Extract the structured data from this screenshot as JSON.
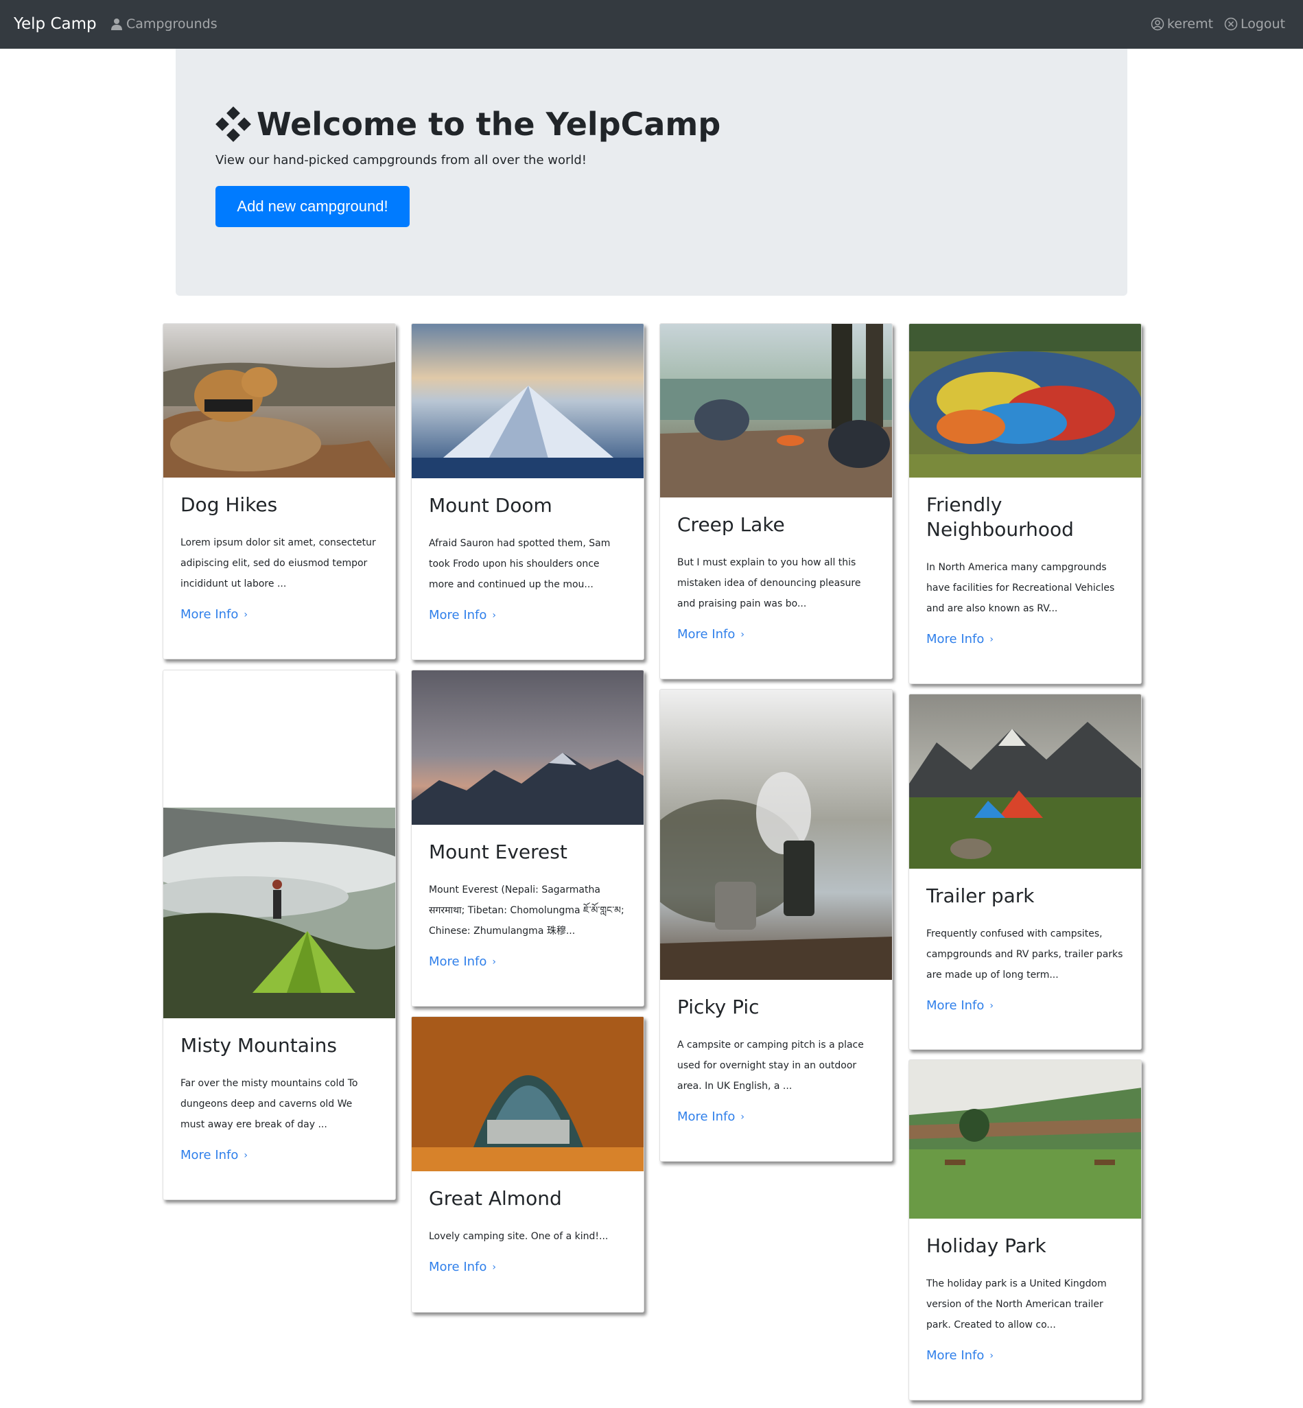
{
  "navbar": {
    "brand": "Yelp Camp",
    "campgrounds_label": "Campgrounds",
    "username": "keremt",
    "logout_label": "Logout"
  },
  "jumbotron": {
    "title": "Welcome to the YelpCamp",
    "lead": "View our hand-picked campgrounds from all over the world!",
    "add_button": "Add new campground!"
  },
  "more_info_label": "More Info",
  "campgrounds": [
    {
      "title": "Dog Hikes",
      "description": "Lorem ipsum dolor sit amet, consectetur adipiscing elit, sed do eiusmod tempor incididunt ut labore ..."
    },
    {
      "title": "Mount Doom",
      "description": "Afraid Sauron had spotted them, Sam took Frodo upon his shoulders once more and continued up the mou..."
    },
    {
      "title": "Creep Lake",
      "description": "But I must explain to you how all this mistaken idea of denouncing pleasure and praising pain was bo..."
    },
    {
      "title": "Friendly Neighbourhood",
      "description": "In North America many campgrounds have facilities for Recreational Vehicles and are also known as RV..."
    },
    {
      "title": "Misty Mountains",
      "description": "Far over the misty mountains cold To dungeons deep and caverns old We must away ere break of day ..."
    },
    {
      "title": "Mount Everest",
      "description": "Mount Everest (Nepali: Sagarmatha सगरमाथा; Tibetan: Chomolungma ཇོ་མོ་གླང་མ; Chinese: Zhumulangma 珠穆..."
    },
    {
      "title": "Picky Pic",
      "description": "A campsite or camping pitch is a place used for overnight stay in an outdoor area. In UK English, a ..."
    },
    {
      "title": "Trailer park",
      "description": "Frequently confused with campsites, campgrounds and RV parks, trailer parks are made up of long term..."
    },
    {
      "title": "Great Almond",
      "description": "Lovely camping site. One of a kind!..."
    },
    {
      "title": "Holiday Park",
      "description": "The holiday park is a United Kingdom version of the North American trailer park. Created to allow co..."
    }
  ],
  "colors": {
    "navbar_bg": "#343a40",
    "jumbotron_bg": "#e9ecef",
    "primary": "#007bff",
    "link": "#2f7fea"
  }
}
